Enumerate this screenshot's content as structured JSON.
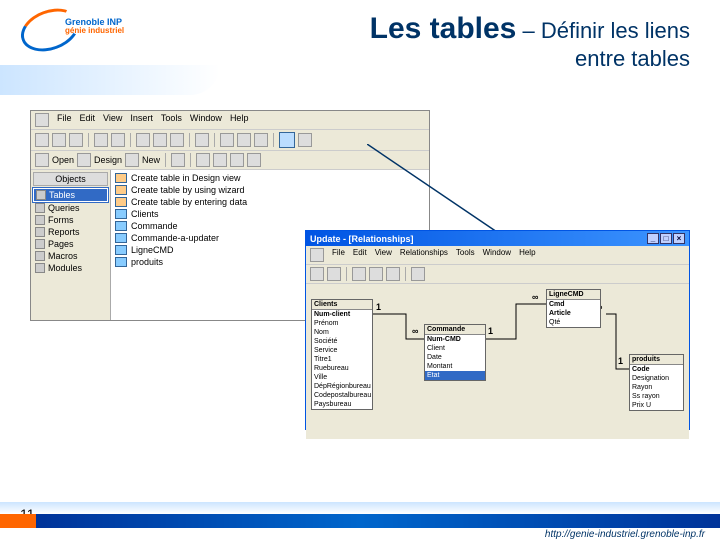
{
  "slide": {
    "title_main": "Les tables",
    "title_sep": " – ",
    "title_sub1": "Définir les liens",
    "title_sub2": "entre tables",
    "page_number": "11",
    "footer_url": "http://genie-industriel.grenoble-inp.fr",
    "logo_line1": "Grenoble",
    "logo_line2": "INP",
    "logo_line3": "génie industriel"
  },
  "db_window": {
    "menu": [
      "File",
      "Edit",
      "View",
      "Insert",
      "Tools",
      "Window",
      "Help"
    ],
    "toolbar2": {
      "open": "Open",
      "design": "Design",
      "new": "New"
    },
    "sidebar_header": "Objects",
    "sidebar": [
      {
        "label": "Tables",
        "selected": true
      },
      {
        "label": "Queries",
        "selected": false
      },
      {
        "label": "Forms",
        "selected": false
      },
      {
        "label": "Reports",
        "selected": false
      },
      {
        "label": "Pages",
        "selected": false
      },
      {
        "label": "Macros",
        "selected": false
      },
      {
        "label": "Modules",
        "selected": false
      }
    ],
    "objects": [
      {
        "label": "Create table in Design view",
        "wizard": true
      },
      {
        "label": "Create table by using wizard",
        "wizard": true
      },
      {
        "label": "Create table by entering data",
        "wizard": true
      },
      {
        "label": "Clients",
        "wizard": false
      },
      {
        "label": "Commande",
        "wizard": false
      },
      {
        "label": "Commande-a-updater",
        "wizard": false
      },
      {
        "label": "LigneCMD",
        "wizard": false
      },
      {
        "label": "produits",
        "wizard": false
      }
    ]
  },
  "rel_window": {
    "title": "Update - [Relationships]",
    "menu": [
      "File",
      "Edit",
      "View",
      "Relationships",
      "Tools",
      "Window",
      "Help"
    ],
    "tables": {
      "clients": {
        "name": "Clients",
        "fields": [
          "Num-client",
          "Prénom",
          "Nom",
          "Société",
          "Service",
          "Titre1",
          "Ruebureau",
          "Ville",
          "DépRégionbureau",
          "Codepostalbureau",
          "Paysbureau"
        ]
      },
      "commande": {
        "name": "Commande",
        "fields": [
          "Num-CMD",
          "Client",
          "Date",
          "Montant",
          "Etat"
        ]
      },
      "lignecmd": {
        "name": "LigneCMD",
        "fields": [
          "Cmd",
          "Article",
          "Qté"
        ]
      },
      "produits": {
        "name": "produits",
        "fields": [
          "Code",
          "Designation",
          "Rayon",
          "Ss rayon",
          "Prix U"
        ]
      }
    },
    "cardinality": {
      "one": "1",
      "many": "∞"
    }
  }
}
